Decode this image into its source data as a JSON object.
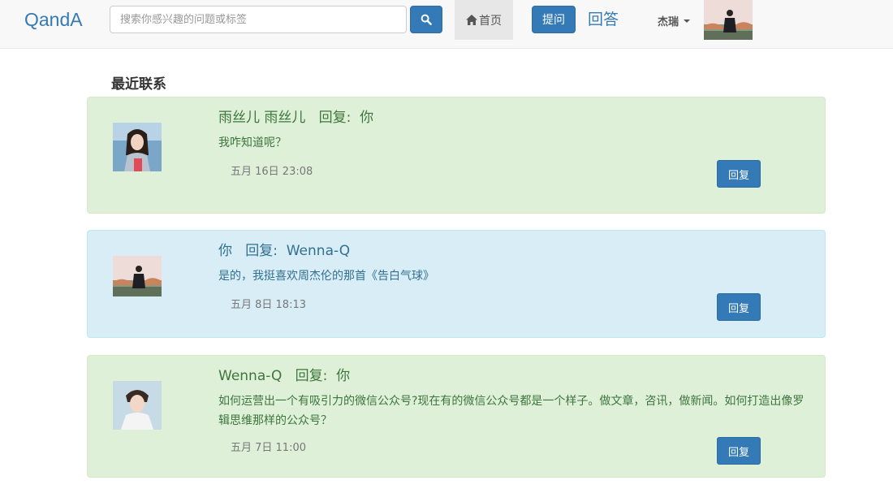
{
  "navbar": {
    "brand": "QandA",
    "search": {
      "placeholder": "搜索你感兴趣的问题或标签",
      "value": ""
    },
    "search_icon": "search-icon",
    "home_label": "首页",
    "home_icon": "home-icon",
    "ask_label": "提问",
    "answer_label": "回答",
    "user_name": "杰瑞"
  },
  "section_title": "最近联系",
  "messages": [
    {
      "style": "success",
      "heading": "雨丝儿 雨丝儿   回复:  你",
      "content": "我咋知道呢？",
      "time": "五月 16日 23:08",
      "reply_label": "回复"
    },
    {
      "style": "info",
      "heading": "你   回复:  Wenna-Q",
      "content": "是的，我挺喜欢周杰伦的那首《告白气球》",
      "time": "五月 8日 18:13",
      "reply_label": "回复"
    },
    {
      "style": "success",
      "heading": "Wenna-Q   回复:  你",
      "content": "如何运营出一个有吸引力的微信公众号?现在有的微信公众号都是一个样子。做文章，咨讯，做新闻。如何打造出像罗辑思维那样的公众号？",
      "time": "五月 7日 11:00",
      "reply_label": "回复"
    }
  ],
  "colors": {
    "primary": "#337ab7",
    "success_bg": "#dff0d8",
    "success_text": "#3c763d",
    "info_bg": "#d9edf7",
    "info_text": "#31708f"
  }
}
